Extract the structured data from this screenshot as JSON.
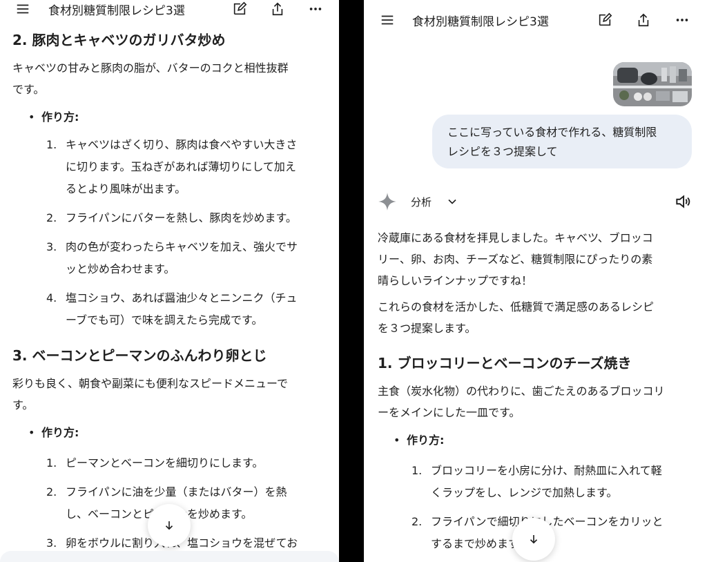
{
  "left": {
    "title": "食材別糖質制限レシピ3選",
    "sections": [
      {
        "heading": "2. 豚肉とキャベツのガリバタ炒め",
        "desc": [
          "キャベツの甘みと豚肉の脂が、バターのコクと相性抜群",
          "です。"
        ],
        "howto": "作り方:",
        "steps": [
          {
            "num": "1.",
            "lines": [
              "キャベツはざく切り、豚肉は食べやすい大きさ",
              "に切ります。玉ねぎがあれば薄切りにして加え",
              "るとより風味が出ます。"
            ]
          },
          {
            "num": "2.",
            "lines": [
              "フライパンにバターを熱し、豚肉を炒めます。"
            ]
          },
          {
            "num": "3.",
            "lines": [
              "肉の色が変わったらキャベツを加え、強火でサ",
              "ッと炒め合わせます。"
            ]
          },
          {
            "num": "4.",
            "lines": [
              "塩コショウ、あれば醤油少々とニンニク（チュ",
              "ーブでも可）で味を調えたら完成です。"
            ]
          }
        ]
      },
      {
        "heading": "3. ベーコンとピーマンのふんわり卵とじ",
        "desc": [
          "彩りも良く、朝食や副菜にも便利なスピードメニューで",
          "す。"
        ],
        "howto": "作り方:",
        "steps": [
          {
            "num": "1.",
            "lines": [
              "ピーマンとベーコンを細切りにします。"
            ]
          },
          {
            "num": "2.",
            "lines": [
              "フライパンに油を少量（またはバター）を熱",
              "し、ベーコンとピーマンを炒めます。"
            ]
          },
          {
            "num": "3.",
            "lines": [
              "卵をボウルに割り入れ、塩コショウを混ぜてお"
            ]
          }
        ]
      }
    ]
  },
  "right": {
    "title": "食材別糖質制限レシピ3選",
    "user_message": [
      "ここに写っている食材で作れる、糖質制限",
      "レシピを３つ提案して"
    ],
    "analysis_label": "分析",
    "intro": [
      [
        "冷蔵庫にある食材を拝見しました。キャベツ、ブロッコ",
        "リー、卵、お肉、チーズなど、糖質制限にぴったりの素",
        "晴らしいラインナップですね！"
      ],
      [
        "これらの食材を活かした、低糖質で満足感のあるレシピ",
        "を３つ提案します。"
      ]
    ],
    "section": {
      "heading": "1. ブロッコリーとベーコンのチーズ焼き",
      "desc": [
        "主食（炭水化物）の代わりに、歯ごたえのあるブロッコリ",
        "ーをメインにした一皿です。"
      ],
      "howto": "作り方:",
      "steps": [
        {
          "num": "1.",
          "lines": [
            "ブロッコリーを小房に分け、耐熱皿に入れて軽",
            "くラップをし、レンジで加熱します。"
          ]
        },
        {
          "num": "2.",
          "lines": [
            "フライパンで細切りにしたベーコンをカリッと",
            "するまで炒めます。"
          ]
        }
      ]
    }
  },
  "icons": {
    "menu": "menu-icon",
    "edit": "edit-icon",
    "share": "share-icon",
    "more": "more-icon",
    "sparkle": "gemini-sparkle-icon",
    "chevron": "chevron-down-icon",
    "speaker": "speaker-icon",
    "scroll_down": "arrow-down-icon"
  }
}
